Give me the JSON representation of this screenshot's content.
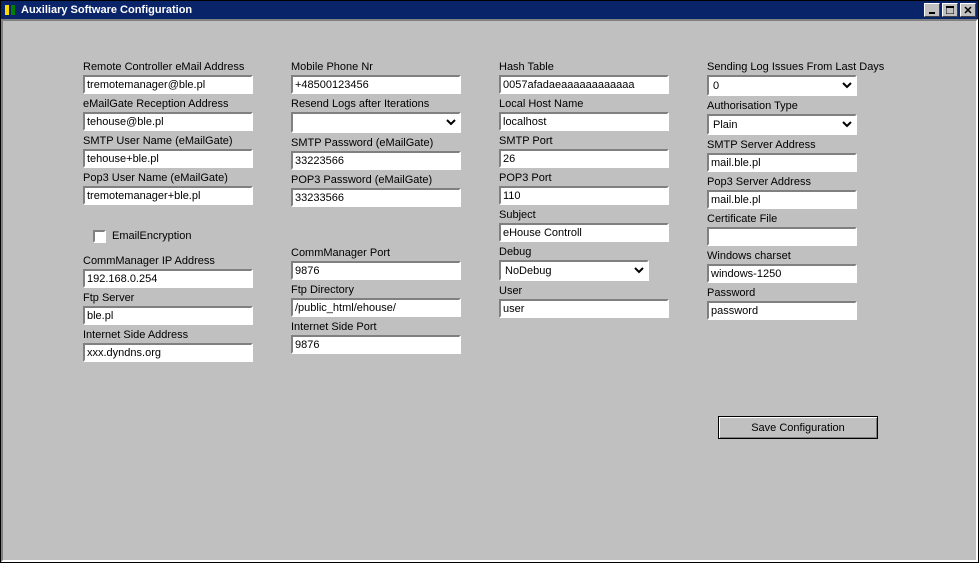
{
  "window": {
    "title": "Auxiliary Software Configuration"
  },
  "col1": {
    "remote_ctrl_email_lbl": "Remote Controller eMail Address",
    "remote_ctrl_email": "tremotemanager@ble.pl",
    "emailgate_recv_lbl": "eMailGate Reception Address",
    "emailgate_recv": "tehouse@ble.pl",
    "smtp_user_lbl": "SMTP User Name (eMailGate)",
    "smtp_user": "tehouse+ble.pl",
    "pop3_user_lbl": "Pop3 User Name (eMailGate)",
    "pop3_user": "tremotemanager+ble.pl",
    "email_encryption_lbl": "EmailEncryption",
    "comm_ip_lbl": "CommManager IP Address",
    "comm_ip": "192.168.0.254",
    "ftp_server_lbl": "Ftp Server",
    "ftp_server": "ble.pl",
    "inet_addr_lbl": "Internet Side Address",
    "inet_addr": "xxx.dyndns.org"
  },
  "col2": {
    "mobile_lbl": "Mobile Phone Nr",
    "mobile": "+48500123456",
    "resend_lbl": "Resend Logs after Iterations",
    "resend": "",
    "smtp_pw_lbl": "SMTP Password (eMailGate)",
    "smtp_pw": "33223566",
    "pop3_pw_lbl": "POP3 Password (eMailGate)",
    "pop3_pw": "33233566",
    "comm_port_lbl": "CommManager Port",
    "comm_port": "9876",
    "ftp_dir_lbl": "Ftp Directory",
    "ftp_dir": "/public_html/ehouse/",
    "inet_port_lbl": "Internet Side Port",
    "inet_port": "9876"
  },
  "col3": {
    "hash_lbl": "Hash Table",
    "hash": "0057afadaeaaaaaaaaaaaa",
    "localhost_lbl": "Local Host Name",
    "localhost": "localhost",
    "smtp_port_lbl": "SMTP Port",
    "smtp_port": "26",
    "pop3_port_lbl": "POP3 Port",
    "pop3_port": "110",
    "subject_lbl": "Subject",
    "subject": "eHouse Controll",
    "debug_lbl": "Debug",
    "debug": "NoDebug",
    "user_lbl": "User",
    "user": "user"
  },
  "col4": {
    "log_days_lbl": "Sending Log Issues From Last Days",
    "log_days": "0",
    "auth_lbl": "Authorisation Type",
    "auth": "Plain",
    "smtp_srv_lbl": "SMTP Server Address",
    "smtp_srv": "mail.ble.pl",
    "pop3_srv_lbl": "Pop3 Server Address",
    "pop3_srv": "mail.ble.pl",
    "cert_lbl": "Certificate File",
    "cert": "",
    "charset_lbl": "Windows charset",
    "charset": "windows-1250",
    "pw_lbl": "Password",
    "pw": "password"
  },
  "buttons": {
    "save": "Save Configuration"
  }
}
